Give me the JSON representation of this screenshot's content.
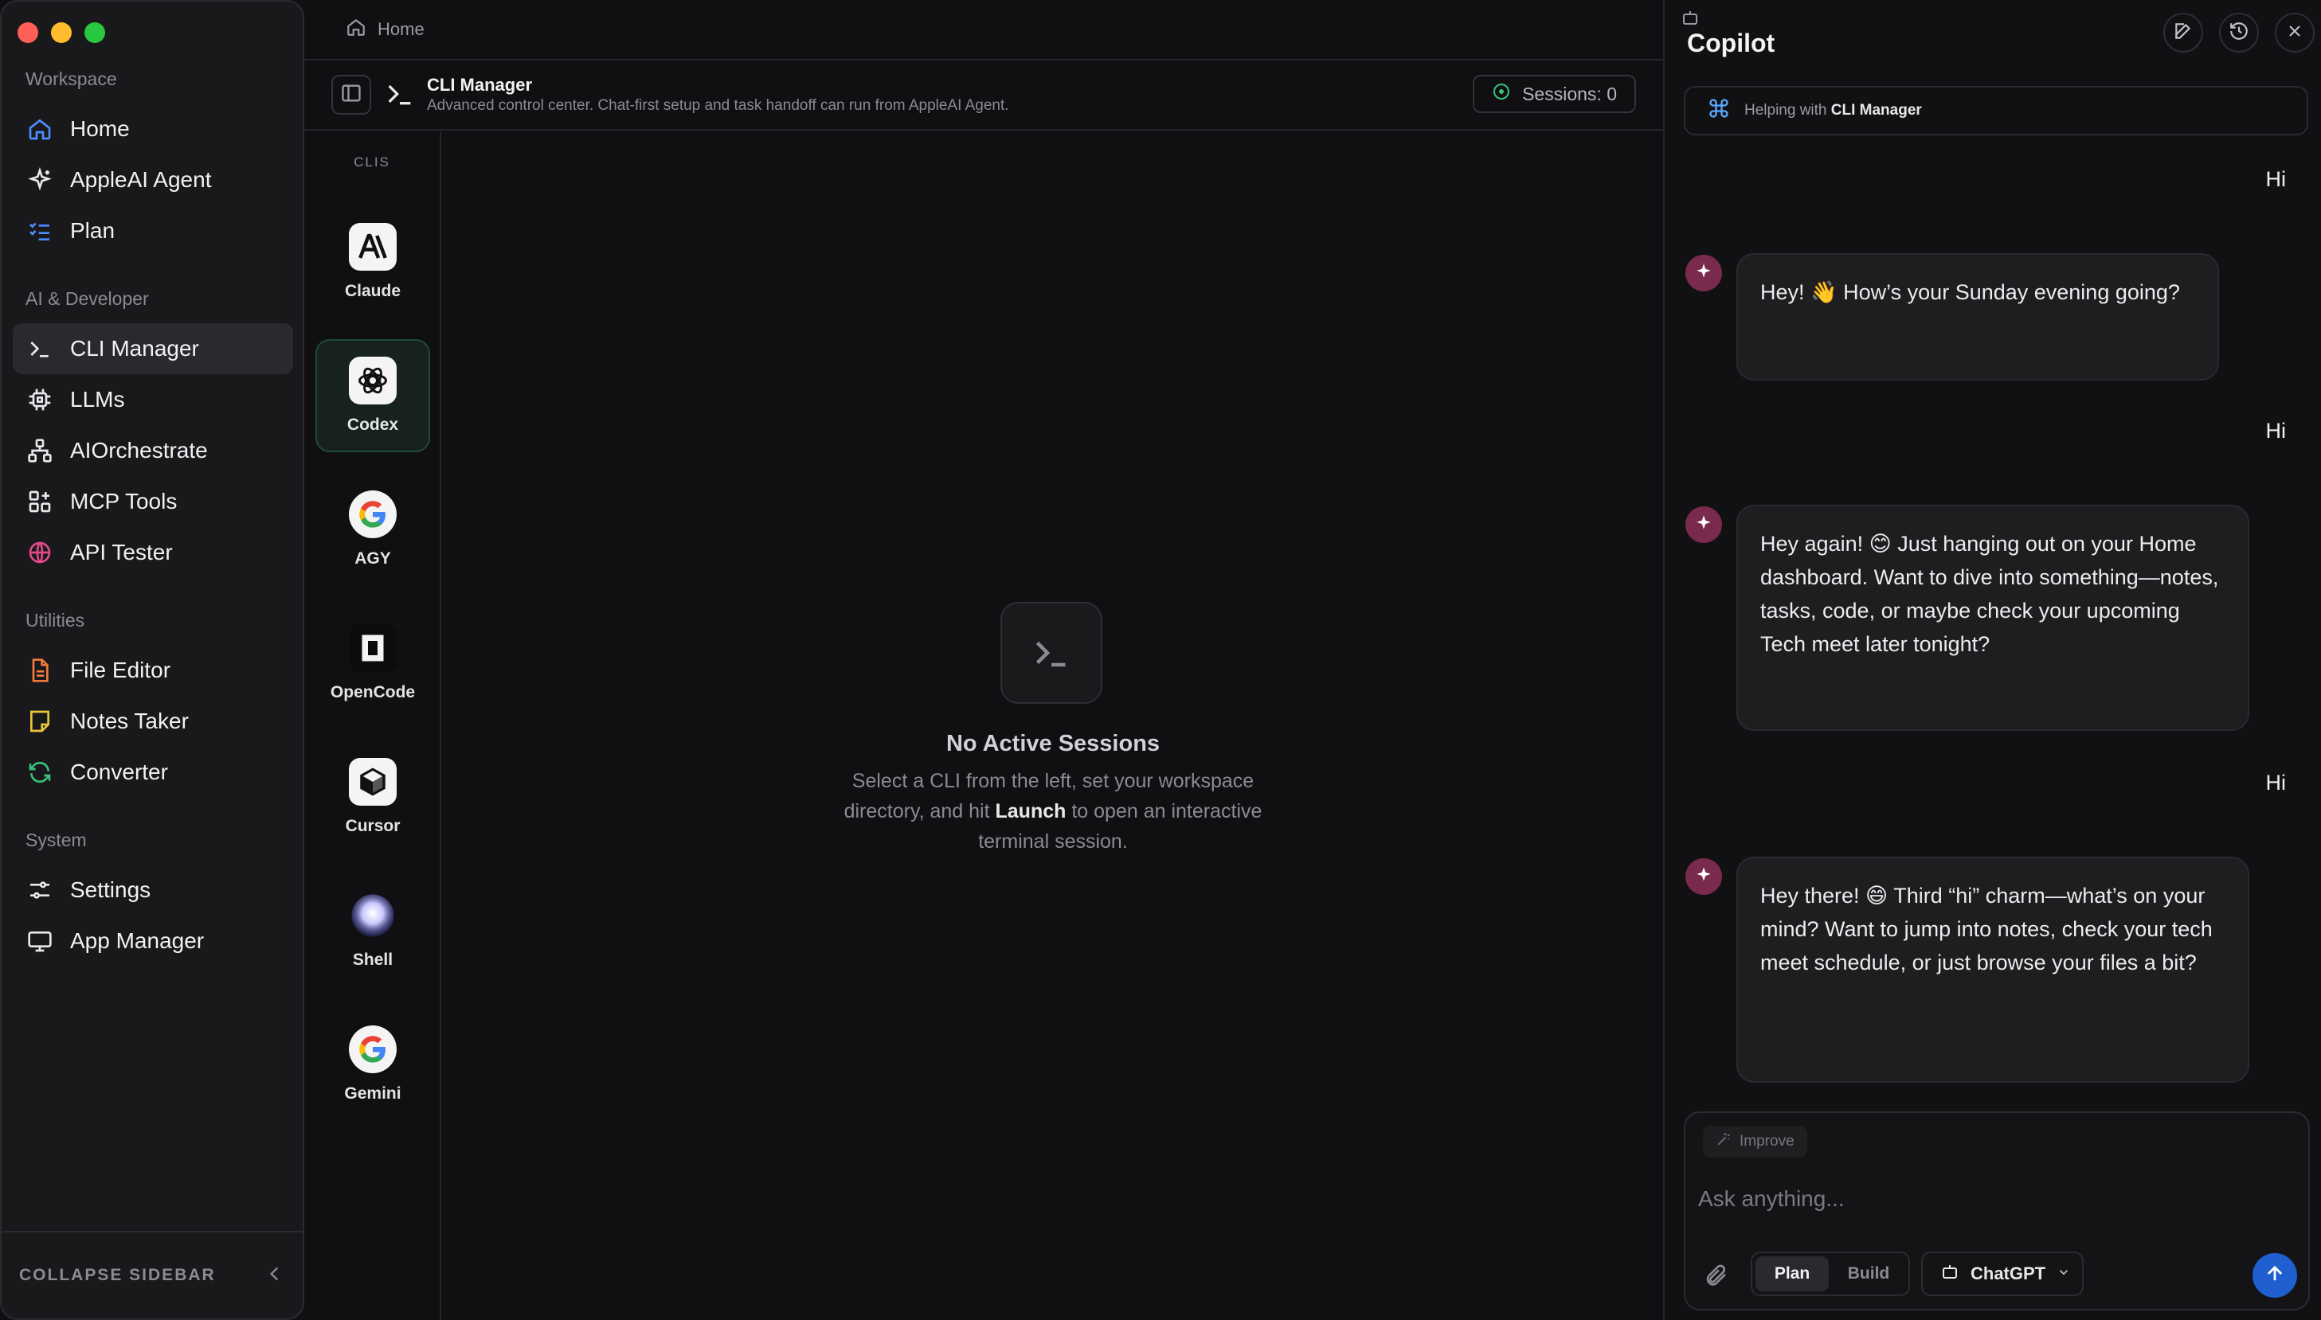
{
  "window": {
    "traffic_colors": [
      "#fe5f57",
      "#febc2e",
      "#28c840"
    ]
  },
  "sidebar": {
    "groups": [
      {
        "label": "Workspace"
      },
      {
        "label": "AI & Developer"
      },
      {
        "label": "Utilities"
      },
      {
        "label": "System"
      }
    ],
    "items": [
      {
        "label": "Home",
        "icon": "home-icon",
        "color": "#4d8dff"
      },
      {
        "label": "AppleAI Agent",
        "icon": "sparkle-icon",
        "color": "#e8e8ea"
      },
      {
        "label": "Plan",
        "icon": "checklist-icon",
        "color": "#4d8dff"
      },
      {
        "label": "CLI Manager",
        "icon": "terminal-icon",
        "color": "#e8e8ea",
        "active": true
      },
      {
        "label": "LLMs",
        "icon": "chip-icon",
        "color": "#e8e8ea"
      },
      {
        "label": "AIOrchestrate",
        "icon": "workflow-icon",
        "color": "#e8e8ea"
      },
      {
        "label": "MCP Tools",
        "icon": "puzzle-icon",
        "color": "#e8e8ea"
      },
      {
        "label": "API Tester",
        "icon": "globe-icon",
        "color": "#e04a8a"
      },
      {
        "label": "File Editor",
        "icon": "file-icon",
        "color": "#f07a3a"
      },
      {
        "label": "Notes Taker",
        "icon": "note-icon",
        "color": "#e8c53a"
      },
      {
        "label": "Converter",
        "icon": "refresh-icon",
        "color": "#3ac07a"
      },
      {
        "label": "Settings",
        "icon": "sliders-icon",
        "color": "#e8e8ea"
      },
      {
        "label": "App Manager",
        "icon": "monitor-icon",
        "color": "#e8e8ea"
      }
    ],
    "collapse_label": "COLLAPSE SIDEBAR"
  },
  "breadcrumb": {
    "label": "Home"
  },
  "header": {
    "title": "CLI Manager",
    "subtitle": "Advanced control center. Chat-first setup and task handoff can run from AppleAI Agent.",
    "sessions_label": "Sessions: 0"
  },
  "cli_list": {
    "label": "CLIS",
    "items": [
      {
        "name": "Claude",
        "icon": "claude-logo-icon"
      },
      {
        "name": "Codex",
        "icon": "openai-logo-icon",
        "selected": true
      },
      {
        "name": "AGY",
        "icon": "google-logo-icon"
      },
      {
        "name": "OpenCode",
        "icon": "opencode-logo-icon"
      },
      {
        "name": "Cursor",
        "icon": "cursor-logo-icon"
      },
      {
        "name": "Shell",
        "icon": "shell-orb-icon"
      },
      {
        "name": "Gemini",
        "icon": "google-logo-icon"
      }
    ]
  },
  "empty_state": {
    "title": "No Active Sessions",
    "desc_before": "Select a CLI from the left, set your workspace directory, and hit ",
    "desc_bold": "Launch",
    "desc_after": " to open an interactive terminal session."
  },
  "copilot": {
    "title": "Copilot",
    "context_prefix": "Helping with ",
    "context_target": "CLI Manager",
    "messages": [
      {
        "role": "user",
        "text": "Hi"
      },
      {
        "role": "assistant",
        "text": "Hey! 👋 How’s your Sunday evening going?"
      },
      {
        "role": "user",
        "text": "Hi"
      },
      {
        "role": "assistant",
        "text": "Hey again! 😊 Just hanging out on your Home dashboard. Want to dive into something—notes, tasks, code, or maybe check your upcoming Tech meet later tonight?"
      },
      {
        "role": "user",
        "text": "Hi"
      },
      {
        "role": "assistant",
        "text": "Hey there! 😄 Third “hi” charm—what’s on your mind? Want to jump into notes, check your tech meet schedule, or just browse your files a bit?"
      }
    ],
    "composer": {
      "improve_label": "Improve",
      "placeholder": "Ask anything...",
      "mode_plan": "Plan",
      "mode_build": "Build",
      "model_label": "ChatGPT"
    }
  }
}
